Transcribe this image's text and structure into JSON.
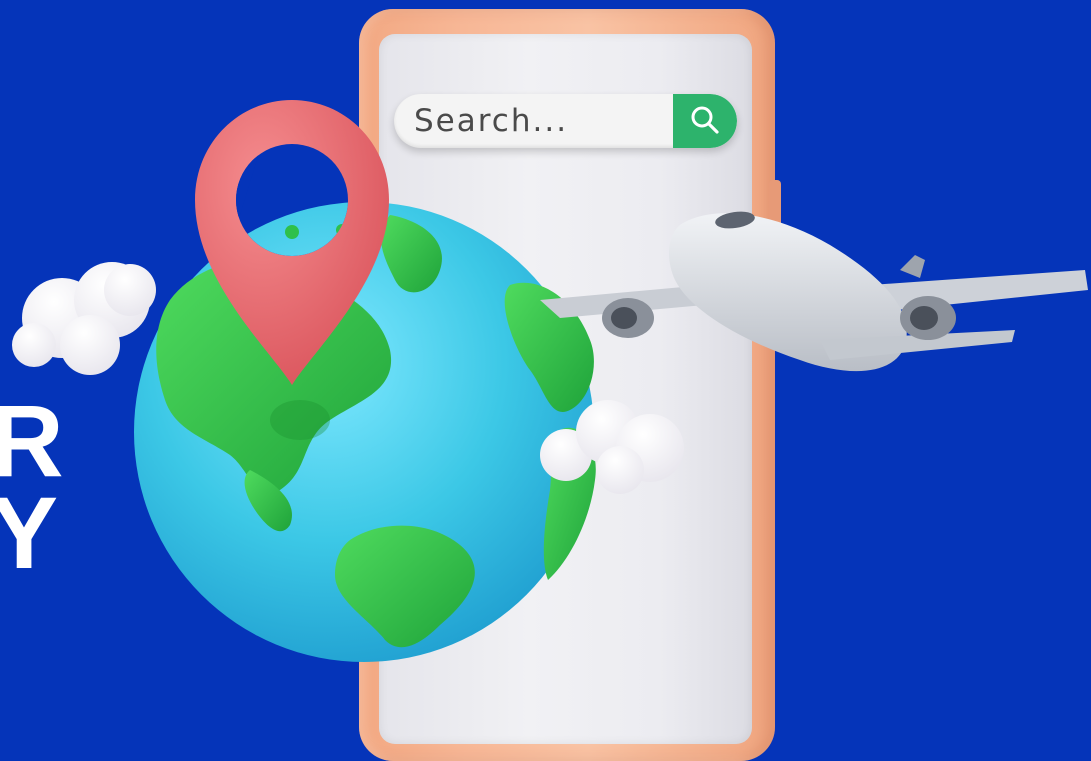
{
  "headline": {
    "line1": "R",
    "line2": "Y"
  },
  "search": {
    "placeholder": "Search...",
    "button_icon": "search-icon"
  },
  "illustration": {
    "globe_icon": "globe-icon",
    "pin_icon": "location-pin-icon",
    "airplane_icon": "airplane-icon",
    "cloud_icon": "cloud-icon"
  },
  "colors": {
    "background": "#0534b9",
    "phone_frame": "#f7b796",
    "screen": "#ececf1",
    "search_button": "#2db36c",
    "ocean": "#3cc8e6",
    "land": "#2fc04a",
    "pin": "#e8676c",
    "plane": "#d9dde3",
    "cloud": "#ffffff"
  }
}
